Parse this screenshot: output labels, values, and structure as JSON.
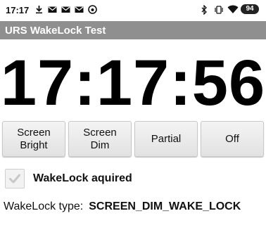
{
  "status_bar": {
    "time": "17:17",
    "battery_level": "94",
    "icons": [
      "download-icon",
      "mail-icon",
      "mail-icon",
      "mail-icon",
      "vodafone-icon",
      "bluetooth-icon",
      "vibrate-icon",
      "wifi-icon",
      "battery-icon"
    ]
  },
  "app_bar": {
    "title": "URS WakeLock Test"
  },
  "clock": {
    "time": "17:17:56"
  },
  "buttons": {
    "screen_bright": "Screen\nBright",
    "screen_dim": "Screen\nDim",
    "partial": "Partial",
    "off": "Off"
  },
  "wakelock": {
    "checkbox_label": "WakeLock aquired",
    "checked": true,
    "type_label": "WakeLock type:",
    "type_value": "SCREEN_DIM_WAKE_LOCK"
  },
  "colors": {
    "action_bar": "#8f8f8f",
    "button_bg": "#e8e8e8",
    "text": "#111111"
  }
}
